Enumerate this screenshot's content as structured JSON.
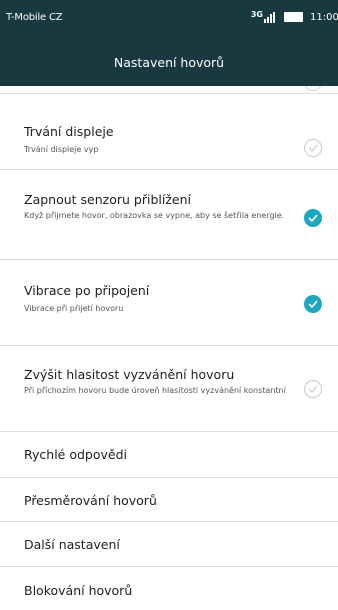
{
  "status_bar": {
    "carrier": "T-Mobile CZ",
    "network": "3G",
    "time": "11:00"
  },
  "header": {
    "title": "Nastavení hovorů"
  },
  "settings": [
    {
      "title": "Trvání displeje",
      "subtitle": "Trvání displeje vyp",
      "checked": false
    },
    {
      "title": "Zapnout senzoru přiblížení",
      "subtitle": "Když přijmete hovor, obrazovka se vypne, aby se šetřila energie.",
      "checked": true
    },
    {
      "title": "Vibrace po připojení",
      "subtitle": "Vibrace při přijetí hovoru",
      "checked": true
    },
    {
      "title": "Zvýšit hlasitost vyzvánění hovoru",
      "subtitle": "Při příchozím hovoru bude úroveň hlasitosti vyzvánění konstantní",
      "checked": false
    },
    {
      "title": "Rychlé odpovědi"
    },
    {
      "title": "Přesměrování hovorů"
    },
    {
      "title": "Další nastavení"
    },
    {
      "title": "Blokování hovorů"
    }
  ],
  "colors": {
    "header_bg": "#18393f",
    "accent": "#1da6c0"
  },
  "icons": {
    "check_on": "check-circle-filled-icon",
    "check_off": "check-circle-outline-icon"
  }
}
